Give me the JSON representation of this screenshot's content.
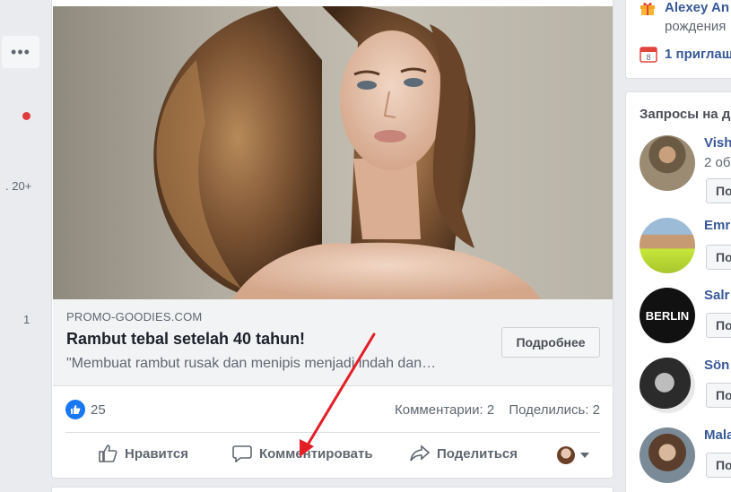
{
  "left_column": {
    "more_label": "•••",
    "count_1": ". 20+",
    "count_2": "1"
  },
  "post": {
    "link": {
      "domain": "PROMO-GOODIES.COM",
      "title": "Rambut tebal setelah 40 tahun!",
      "description": "\"Membuat rambut rusak dan menipis menjadi indah dan…",
      "button_label": "Подробнее"
    },
    "stats": {
      "likes": "25",
      "comments": "Комментарии: 2",
      "shares": "Поделились: 2"
    },
    "actions": {
      "like": "Нравится",
      "comment": "Комментировать",
      "share": "Поделиться"
    }
  },
  "right": {
    "birthday": {
      "name": "Alexey An",
      "sub": "рождения"
    },
    "invite": "1 приглаш",
    "requests": {
      "title": "Запросы на д",
      "items": [
        {
          "name": "Vish",
          "sub": "2 об",
          "button": "Под"
        },
        {
          "name": "Emr",
          "sub": "",
          "button": "По"
        },
        {
          "name": "Salr",
          "sub": "",
          "button": "По"
        },
        {
          "name": "Sön",
          "sub": "",
          "button": "По"
        },
        {
          "name": "Mala",
          "sub": "",
          "button": "По"
        }
      ],
      "berlin_text": "BERLIN"
    }
  },
  "colors": {
    "facebook_blue": "#385898",
    "like_blue": "#1877f2",
    "arrow_red": "#e41e25",
    "background": "#e9ebee"
  }
}
